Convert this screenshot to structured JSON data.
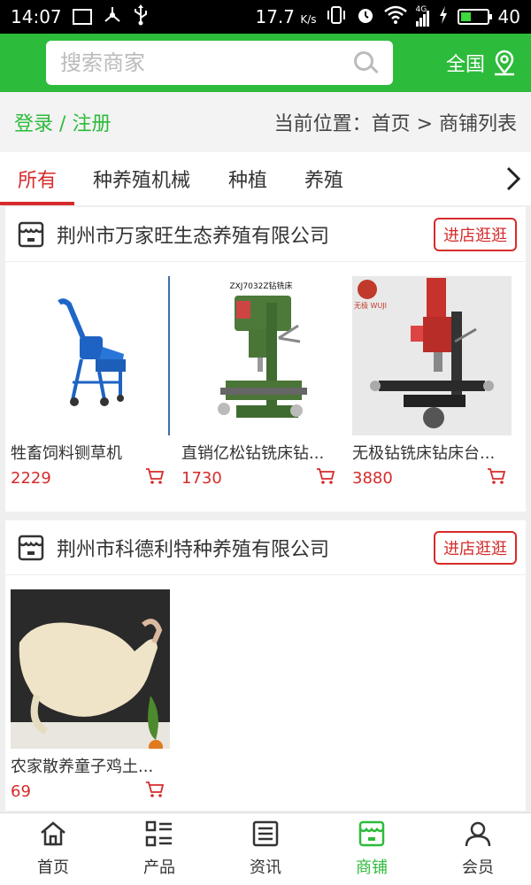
{
  "status_bar": {
    "time": "14:07",
    "speed": "17.7",
    "speed_unit": "K/s",
    "network": "4G",
    "battery": "40",
    "battery_level": 0.4
  },
  "header": {
    "search_placeholder": "搜索商家",
    "region_label": "全国"
  },
  "breadcrumb": {
    "login": "登录",
    "separator": "/",
    "register": "注册",
    "location": "当前位置：首页 > 商铺列表"
  },
  "tabs": [
    {
      "label": "所有",
      "active": true
    },
    {
      "label": "种养殖机械",
      "active": false
    },
    {
      "label": "种植",
      "active": false
    },
    {
      "label": "养殖",
      "active": false
    }
  ],
  "shops": [
    {
      "name": "荆州市万家旺生态养殖有限公司",
      "enter_label": "进店逛逛",
      "products": [
        {
          "name": "牲畜饲料铡草机",
          "price": "2229",
          "image": "chaff-cutter-image"
        },
        {
          "name": "直销亿松钻铣床钻...",
          "price": "1730",
          "image": "drill-press-image",
          "image_caption": "ZXJ7032Z钻铣床"
        },
        {
          "name": "无极钻铣床钻床台...",
          "price": "3880",
          "image": "milling-machine-image",
          "image_brand": "无极 WUJI"
        }
      ]
    },
    {
      "name": "荆州市科德利特种养殖有限公司",
      "enter_label": "进店逛逛",
      "products": [
        {
          "name": "农家散养童子鸡土...",
          "price": "69",
          "image": "chicken-image"
        }
      ]
    }
  ],
  "bottom_nav": [
    {
      "label": "首页",
      "icon": "home-icon",
      "active": false
    },
    {
      "label": "产品",
      "icon": "list-icon",
      "active": false
    },
    {
      "label": "资讯",
      "icon": "news-icon",
      "active": false
    },
    {
      "label": "商铺",
      "icon": "shop-icon",
      "active": true
    },
    {
      "label": "会员",
      "icon": "user-icon",
      "active": false
    }
  ],
  "colors": {
    "brand_green": "#2dbb3b",
    "accent_red": "#d62b2b"
  }
}
